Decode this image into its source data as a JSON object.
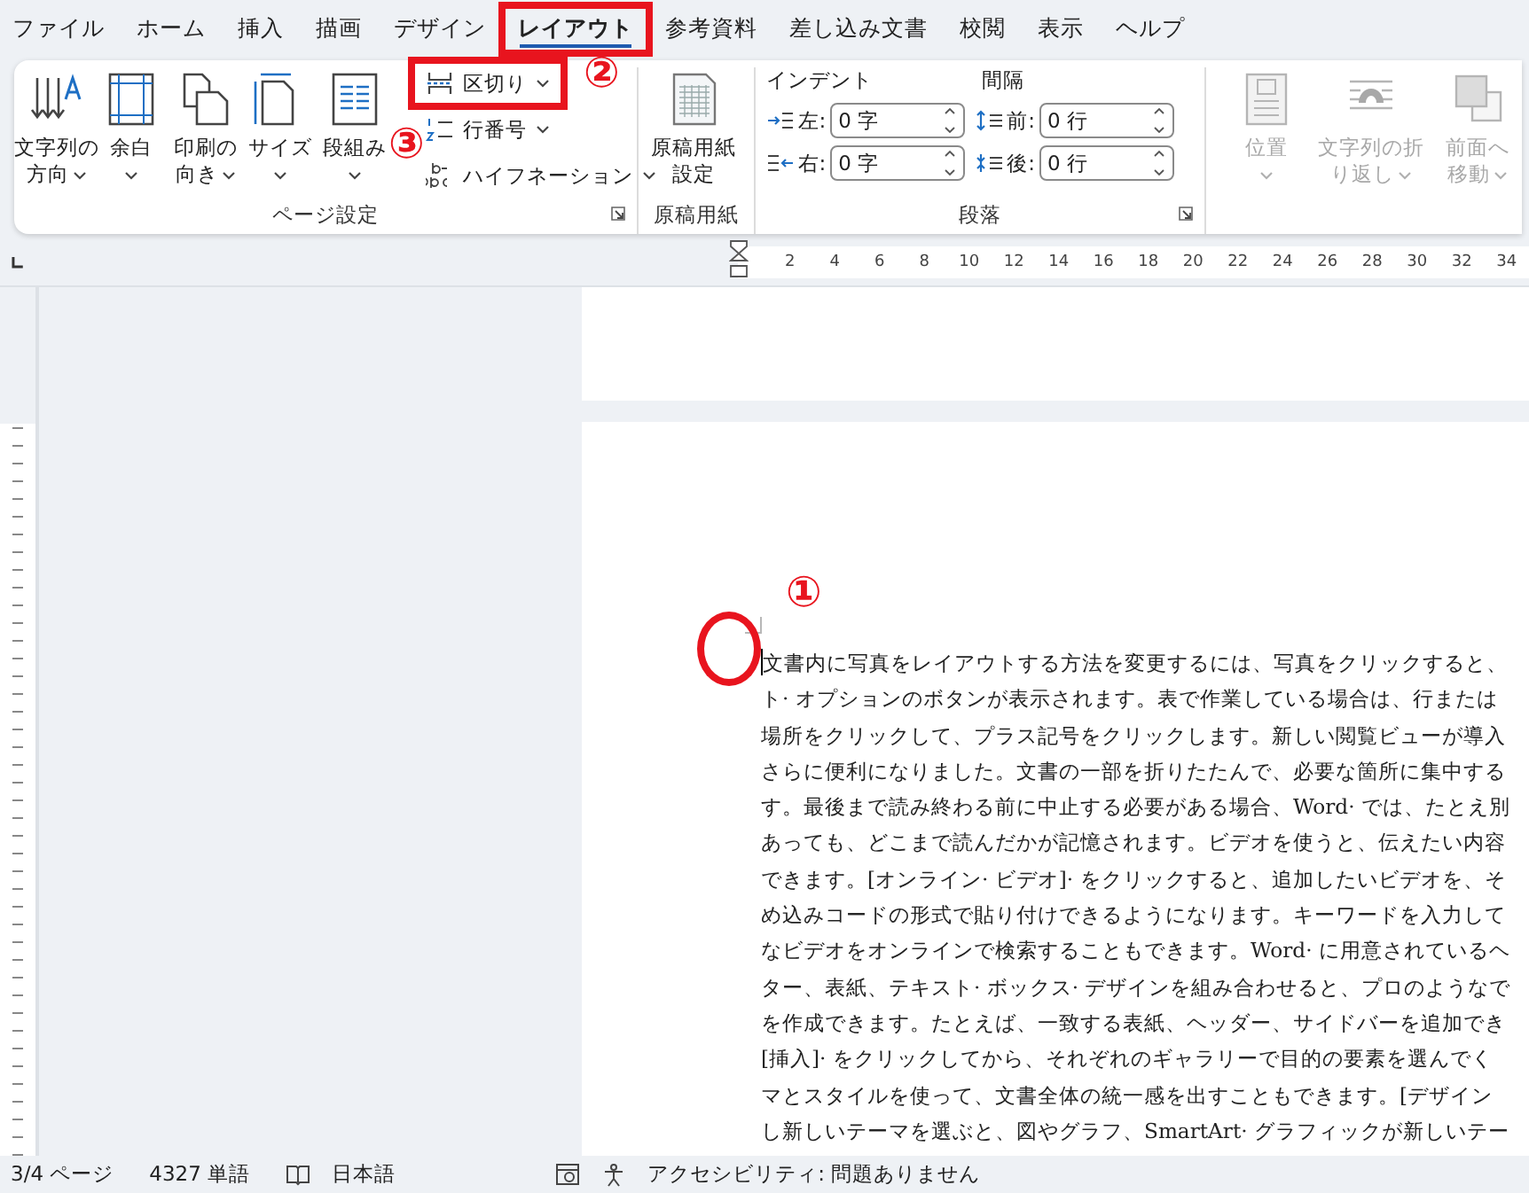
{
  "menu_tabs": [
    {
      "label": "ファイル",
      "selected": false,
      "highlighted": false
    },
    {
      "label": "ホーム",
      "selected": false,
      "highlighted": false
    },
    {
      "label": "挿入",
      "selected": false,
      "highlighted": false
    },
    {
      "label": "描画",
      "selected": false,
      "highlighted": false
    },
    {
      "label": "デザイン",
      "selected": false,
      "highlighted": false
    },
    {
      "label": "レイアウト",
      "selected": true,
      "highlighted": true
    },
    {
      "label": "参考資料",
      "selected": false,
      "highlighted": false
    },
    {
      "label": "差し込み文書",
      "selected": false,
      "highlighted": false
    },
    {
      "label": "校閲",
      "selected": false,
      "highlighted": false
    },
    {
      "label": "表示",
      "selected": false,
      "highlighted": false
    },
    {
      "label": "ヘルプ",
      "selected": false,
      "highlighted": false
    }
  ],
  "ribbon_groups": [
    {
      "kind": "page_setup",
      "label": "ページ設定",
      "launcher": true,
      "large_buttons": [
        {
          "lines": [
            "文字列の",
            "方向"
          ],
          "dropdown": true,
          "disabled": false
        },
        {
          "lines": [
            "余白"
          ],
          "dropdown": true,
          "disabled": false
        },
        {
          "lines": [
            "印刷の",
            "向き"
          ],
          "dropdown": true,
          "disabled": false
        },
        {
          "lines": [
            "サイズ"
          ],
          "dropdown": true,
          "disabled": false
        },
        {
          "lines": [
            "段組み"
          ],
          "dropdown": true,
          "disabled": false
        }
      ],
      "small_buttons": [
        {
          "label": "区切り",
          "dropdown": true,
          "highlighted": true
        },
        {
          "label": "行番号",
          "dropdown": true,
          "highlighted": false
        },
        {
          "label": "ハイフネーション",
          "dropdown": true,
          "highlighted": false
        }
      ]
    },
    {
      "kind": "manuscript",
      "label": "原稿用紙",
      "launcher": false,
      "large_buttons": [
        {
          "lines": [
            "原稿用紙",
            "設定"
          ],
          "dropdown": false,
          "disabled": false
        }
      ]
    },
    {
      "kind": "paragraph",
      "label": "段落",
      "launcher": true,
      "headers": [
        "インデント",
        "間隔"
      ],
      "spinners": [
        {
          "label": "左:",
          "value": "0 字"
        },
        {
          "label": "右:",
          "value": "0 字"
        },
        {
          "label": "前:",
          "value": "0 行"
        },
        {
          "label": "後:",
          "value": "0 行"
        }
      ]
    },
    {
      "kind": "arrange",
      "large_buttons": [
        {
          "lines": [
            "位置"
          ],
          "dropdown": true,
          "disabled": true
        },
        {
          "lines": [
            "文字列の折",
            "り返し"
          ],
          "dropdown": true,
          "disabled": true
        },
        {
          "lines": [
            "前面へ",
            "移動"
          ],
          "dropdown": true,
          "disabled": true
        }
      ]
    }
  ],
  "ruler": {
    "numbers": [
      "2",
      "4",
      "6",
      "8",
      "10",
      "12",
      "14",
      "16",
      "18",
      "20",
      "22",
      "24",
      "26",
      "28",
      "30",
      "32",
      "34"
    ]
  },
  "document": {
    "lines": [
      "文書内に写真をレイアウトする方法を変更するには、写真をクリックすると、",
      "ト· オプションのボタンが表示されます。表で作業している場合は、行または",
      "場所をクリックして、プラス記号をクリックします。新しい閲覧ビューが導入",
      "さらに便利になりました。文書の一部を折りたたんで、必要な箇所に集中する",
      "す。最後まで読み終わる前に中止する必要がある場合、Word· では、たとえ別",
      "あっても、どこまで読んだかが記憶されます。ビデオを使うと、伝えたい内容",
      "できます。[オンライン· ビデオ]· をクリックすると、追加したいビデオを、そ",
      "め込みコードの形式で貼り付けできるようになります。キーワードを入力して",
      "なビデオをオンラインで検索することもできます。Word· に用意されているヘ",
      "ター、表紙、テキスト· ボックス· デザインを組み合わせると、プロのようなで",
      "を作成できます。たとえば、一致する表紙、ヘッダー、サイドバーを追加でき",
      "[挿入]· をクリックしてから、それぞれのギャラリーで目的の要素を選んでく",
      "マとスタイルを使って、文書全体の統一感を出すこともできます。[デザイン",
      "し新しいテーマを選ぶと、図やグラフ、SmartArt· グラフィックが新しいテー"
    ]
  },
  "status_bar": {
    "items": [
      "3/4 ページ",
      "4327 単語",
      "日本語",
      "アクセシビリティ: 問題ありません"
    ]
  },
  "annotations": [
    {
      "label": "①",
      "ring": true
    },
    {
      "label": "②",
      "ring": false
    },
    {
      "label": "③",
      "ring": false
    }
  ]
}
